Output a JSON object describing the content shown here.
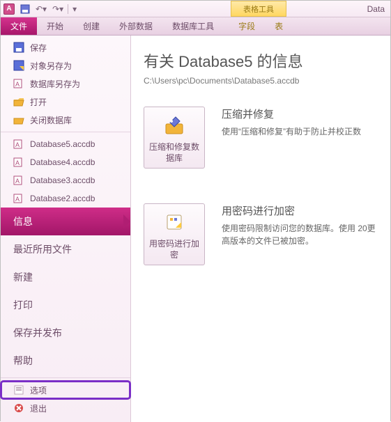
{
  "titlebar": {
    "app": "A",
    "contextual_group": "表格工具",
    "title_right": "Data"
  },
  "ribbon": {
    "file": "文件",
    "tabs": [
      "开始",
      "创建",
      "外部数据",
      "数据库工具"
    ],
    "context_tabs": [
      "字段",
      "表"
    ]
  },
  "sidebar": {
    "quick": [
      {
        "icon": "save-icon",
        "label": "保存"
      },
      {
        "icon": "save-as-icon",
        "label": "对象另存为"
      },
      {
        "icon": "db-save-as-icon",
        "label": "数据库另存为"
      },
      {
        "icon": "open-icon",
        "label": "打开"
      },
      {
        "icon": "close-db-icon",
        "label": "关闭数据库"
      }
    ],
    "recent": [
      "Database5.accdb",
      "Database4.accdb",
      "Database3.accdb",
      "Database2.accdb"
    ],
    "big_items": [
      {
        "key": "info",
        "label": "信息",
        "selected": true
      },
      {
        "key": "recent",
        "label": "最近所用文件"
      },
      {
        "key": "new",
        "label": "新建"
      },
      {
        "key": "print",
        "label": "打印"
      },
      {
        "key": "publish",
        "label": "保存并发布"
      },
      {
        "key": "help",
        "label": "帮助"
      }
    ],
    "bottom": [
      {
        "icon": "options-icon",
        "label": "选项",
        "highlight": true
      },
      {
        "icon": "exit-icon",
        "label": "退出"
      }
    ]
  },
  "info": {
    "title": "有关 Database5 的信息",
    "path": "C:\\Users\\pc\\Documents\\Database5.accdb",
    "actions": [
      {
        "icon": "compact-repair-icon",
        "button_label": "压缩和修复数据库",
        "heading": "压缩并修复",
        "text": "使用“压缩和修复”有助于防止并校正数"
      },
      {
        "icon": "encrypt-icon",
        "button_label": "用密码进行加密",
        "heading": "用密码进行加密",
        "text": "使用密码限制访问您的数据库。使用 20更高版本的文件已被加密。"
      }
    ]
  }
}
